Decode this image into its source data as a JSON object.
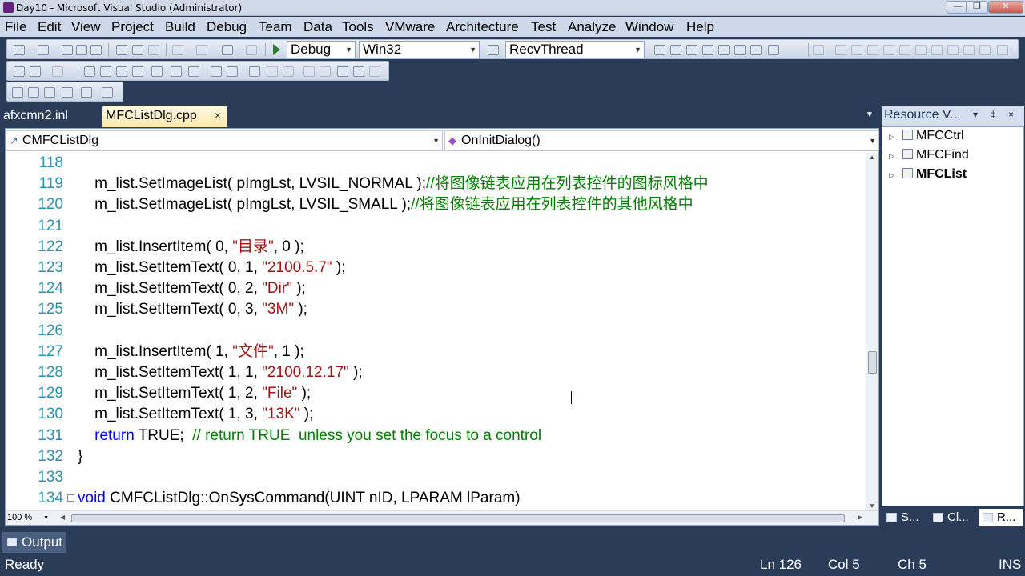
{
  "window": {
    "title": "Day10 - Microsoft Visual Studio (Administrator)",
    "controls": [
      "—",
      "❐",
      "✕"
    ]
  },
  "menu": [
    "File",
    "Edit",
    "View",
    "Project",
    "Build",
    "Debug",
    "Team",
    "Data",
    "Tools",
    "VMware",
    "Architecture",
    "Test",
    "Analyze",
    "Window",
    "Help"
  ],
  "toolbar": {
    "configuration": "Debug",
    "platform": "Win32",
    "find_combo": "RecvThread"
  },
  "tabs": [
    {
      "label": "afxcmn2.inl",
      "active": false
    },
    {
      "label": "MFCListDlg.cpp",
      "active": true,
      "close": "×"
    }
  ],
  "editor": {
    "class_nav": "CMFCListDlg",
    "method_nav": "OnInitDialog()",
    "zoom": "100 %",
    "lines": [
      {
        "n": "118",
        "tokens": []
      },
      {
        "n": "119",
        "tokens": [
          [
            "p",
            "    m_list.SetImageList( pImgLst, LVSIL_NORMAL );"
          ],
          [
            "c",
            "//将图像链表应用在列表控件的图标风格中"
          ]
        ]
      },
      {
        "n": "120",
        "tokens": [
          [
            "p",
            "    m_list.SetImageList( pImgLst, LVSIL_SMALL );"
          ],
          [
            "c",
            "//将图像链表应用在列表控件的其他风格中"
          ]
        ]
      },
      {
        "n": "121",
        "tokens": []
      },
      {
        "n": "122",
        "tokens": [
          [
            "p",
            "    m_list.InsertItem( 0, "
          ],
          [
            "s",
            "\"目录\""
          ],
          [
            "p",
            ", 0 );"
          ]
        ]
      },
      {
        "n": "123",
        "tokens": [
          [
            "p",
            "    m_list.SetItemText( 0, 1, "
          ],
          [
            "s",
            "\"2100.5.7\""
          ],
          [
            "p",
            " );"
          ]
        ]
      },
      {
        "n": "124",
        "tokens": [
          [
            "p",
            "    m_list.SetItemText( 0, 2, "
          ],
          [
            "s",
            "\"Dir\""
          ],
          [
            "p",
            " );"
          ]
        ]
      },
      {
        "n": "125",
        "tokens": [
          [
            "p",
            "    m_list.SetItemText( 0, 3, "
          ],
          [
            "s",
            "\"3M\""
          ],
          [
            "p",
            " );"
          ]
        ]
      },
      {
        "n": "126",
        "tokens": []
      },
      {
        "n": "127",
        "tokens": [
          [
            "p",
            "    m_list.InsertItem( 1, "
          ],
          [
            "s",
            "\"文件\""
          ],
          [
            "p",
            ", 1 );"
          ]
        ]
      },
      {
        "n": "128",
        "tokens": [
          [
            "p",
            "    m_list.SetItemText( 1, 1, "
          ],
          [
            "s",
            "\"2100.12.17\""
          ],
          [
            "p",
            " );"
          ]
        ]
      },
      {
        "n": "129",
        "tokens": [
          [
            "p",
            "    m_list.SetItemText( 1, 2, "
          ],
          [
            "s",
            "\"File\""
          ],
          [
            "p",
            " );"
          ]
        ]
      },
      {
        "n": "130",
        "tokens": [
          [
            "p",
            "    m_list.SetItemText( 1, 3, "
          ],
          [
            "s",
            "\"13K\""
          ],
          [
            "p",
            " );"
          ]
        ]
      },
      {
        "n": "131",
        "tokens": [
          [
            "p",
            "    "
          ],
          [
            "k",
            "return"
          ],
          [
            "p",
            " TRUE;  "
          ],
          [
            "c",
            "// return TRUE  unless you set the focus to a control"
          ]
        ]
      },
      {
        "n": "132",
        "tokens": [
          [
            "p",
            "}"
          ]
        ]
      },
      {
        "n": "133",
        "tokens": []
      },
      {
        "n": "134",
        "tokens": [
          [
            "k",
            "void"
          ],
          [
            "p",
            " CMFCListDlg::OnSysCommand(UINT nID, LPARAM lParam)"
          ]
        ],
        "fold": "−"
      }
    ]
  },
  "resource_view": {
    "title": "Resource V...",
    "header_buttons": [
      "▾",
      "‡",
      "×"
    ],
    "items": [
      {
        "label": "MFCCtrl",
        "bold": false
      },
      {
        "label": "MFCFind",
        "bold": false
      },
      {
        "label": "MFCList",
        "bold": true
      }
    ],
    "tabs": [
      "S...",
      "Cl...",
      "R..."
    ]
  },
  "output_tab": "Output",
  "status": {
    "ready": "Ready",
    "line": "Ln 126",
    "col": "Col 5",
    "ch": "Ch 5",
    "mode": "INS"
  }
}
